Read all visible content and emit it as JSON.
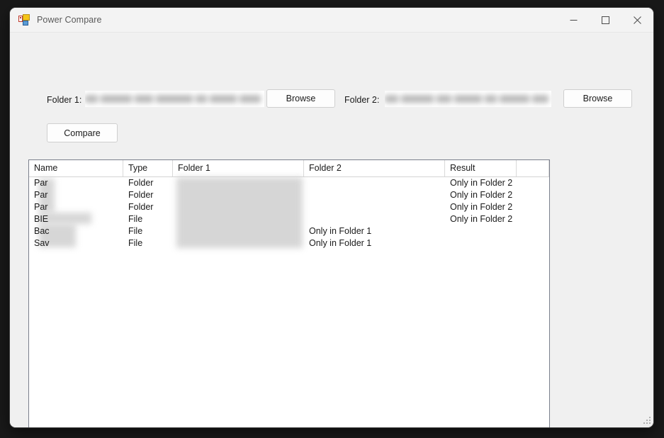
{
  "window": {
    "title": "Power Compare",
    "icon": "winforms-app-icon",
    "controls": {
      "minimize": "minimize-icon",
      "maximize": "maximize-icon",
      "close": "close-icon"
    }
  },
  "form": {
    "folder1_label": "Folder 1:",
    "folder1_path": "",
    "folder1_browse": "Browse",
    "folder2_label": "Folder 2:",
    "folder2_path": "",
    "folder2_browse": "Browse",
    "compare_label": "Compare"
  },
  "grid": {
    "columns": [
      "Name",
      "Type",
      "Folder 1",
      "Folder 2",
      "Result",
      ""
    ],
    "rows": [
      {
        "name": "Par",
        "type": "Folder",
        "folder1": "",
        "folder2": "",
        "result": "Only in Folder 2"
      },
      {
        "name": "Par",
        "type": "Folder",
        "folder1": "",
        "folder2": "",
        "result": "Only in Folder 2"
      },
      {
        "name": "Par",
        "type": "Folder",
        "folder1": "",
        "folder2": "",
        "result": "Only in Folder 2"
      },
      {
        "name": "BIE",
        "type": "File",
        "folder1": "",
        "folder2": "",
        "result": "Only in Folder 2"
      },
      {
        "name": "Bac",
        "type": "File",
        "folder1": "",
        "folder2": "Only in Folder 1",
        "result": ""
      },
      {
        "name": "Sav",
        "type": "File",
        "folder1": "",
        "folder2": "Only in Folder 1",
        "result": ""
      }
    ]
  },
  "colors": {
    "desktop": "#191919",
    "window_bg": "#f0f0f0",
    "titlebar": "#f3f3f3",
    "grid_border": "#7a7f8c",
    "text": "#1a1a1a"
  }
}
